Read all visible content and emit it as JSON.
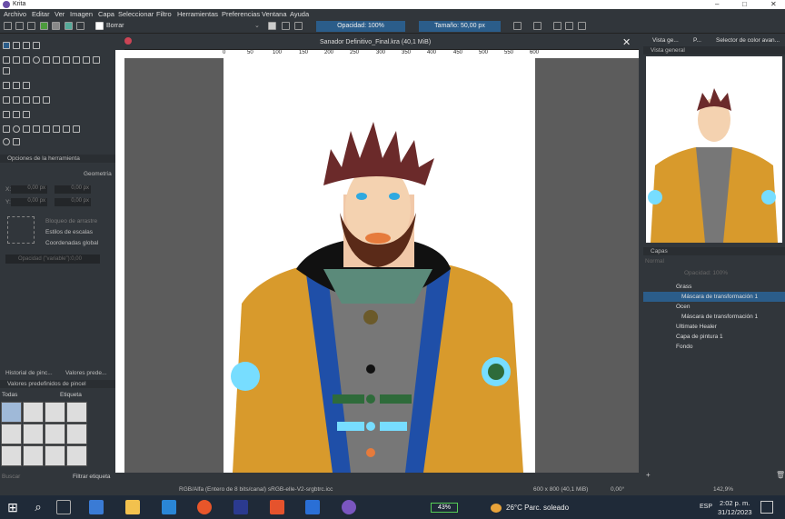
{
  "app": {
    "title": "Krita"
  },
  "menu": [
    "Archivo",
    "Editar",
    "Ver",
    "Imagen",
    "Capa",
    "Seleccionar",
    "Filtro",
    "Herramientas",
    "Preferencias",
    "Ventana",
    "Ayuda"
  ],
  "toolbar": {
    "blend_mode": "Borrar",
    "opacity": "Opacidad: 100%",
    "size": "Tamaño: 50,00 px"
  },
  "document": {
    "tab_title": "Sanador Definitivo_Final.kra (40,1 MiB)",
    "ruler_ticks": [
      "0",
      "50",
      "100",
      "150",
      "200",
      "250",
      "300",
      "350",
      "400",
      "450",
      "500",
      "550",
      "600"
    ]
  },
  "tool_options": {
    "title": "Opciones de la herramienta",
    "geometry": "Geometría",
    "x_label": "X:",
    "y_label": "Y:",
    "x_val": "0,00 px",
    "y_val": "0,00 px",
    "x_val2": "0,00 px",
    "y_val2": "0,00 px",
    "lock": "Bloqueo de arrastre",
    "scale": "Estilos de escalas",
    "global": "Coordenadas global",
    "opacity": "Opacidad (\"variable\"):0,00"
  },
  "brush_presets": {
    "tab1": "Historial de pinc...",
    "tab2": "Valores prede...",
    "title": "Valores predefinidos de pincel",
    "filter": "Todas",
    "tag": "Etiqueta",
    "search": "Buscar",
    "filter_tag": "Filtrar etiqueta"
  },
  "right_dock": {
    "tabs": [
      "Vista ge...",
      "P...",
      "Selector de color avan..."
    ],
    "overview": "Vista general",
    "layers": "Capas",
    "blend": "Normal",
    "opacity": "Opacidad: 100%"
  },
  "layers": [
    {
      "name": "Grass",
      "indent": 0
    },
    {
      "name": "Máscara de transformación 1",
      "indent": 1,
      "selected": true
    },
    {
      "name": "Ocen",
      "indent": 0
    },
    {
      "name": "Máscara de transformación 1",
      "indent": 1
    },
    {
      "name": "Ultimate Healer",
      "indent": 0
    },
    {
      "name": "Capa de pintura 1",
      "indent": 0
    },
    {
      "name": "Fondo",
      "indent": 0
    }
  ],
  "status": {
    "color": "RGB/Alfa (Entero de 8 bits/canal)  sRGB-elle-V2-srgbtrc.icc",
    "size": "600 x 800 (40,1 MiB)",
    "rotation": "0,00°",
    "zoom": "142,9%"
  },
  "taskbar": {
    "battery": "43%",
    "weather": "26°C  Parc. soleado",
    "lang": "ESP",
    "time": "2:02 p. m.",
    "date": "31/12/2023"
  },
  "colors": {
    "accent": "#2b5d8a",
    "taskbar": "#1f2a38"
  }
}
